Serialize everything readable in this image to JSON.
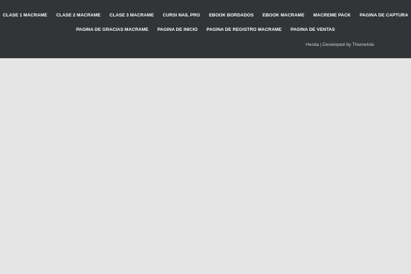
{
  "footer": {
    "menu_row_1": [
      "CLASE 1 MACRAME",
      "CLASE 2 MACRAME",
      "CLASE 3 MACRAME",
      "CURSI NAIL PRO",
      "EBOOK BORDADOS",
      "EBOOK MACRAME",
      "MACREME PACK",
      "PAGINA DE CAPTURA"
    ],
    "menu_row_2": [
      "PAGINA DE GRACIAS MACRAME",
      "PAGINA DE INICIO",
      "PAGINA DE REGISTRO MACRAME",
      "PAGINA DE VENTAS"
    ],
    "copyright": "Hestia | Developed by ThemeIsle"
  },
  "colors": {
    "footer_background": "#323437",
    "page_background": "#e5e5e5",
    "menu_text": "#ffffff",
    "copyright_text": "#cfd0d2"
  }
}
